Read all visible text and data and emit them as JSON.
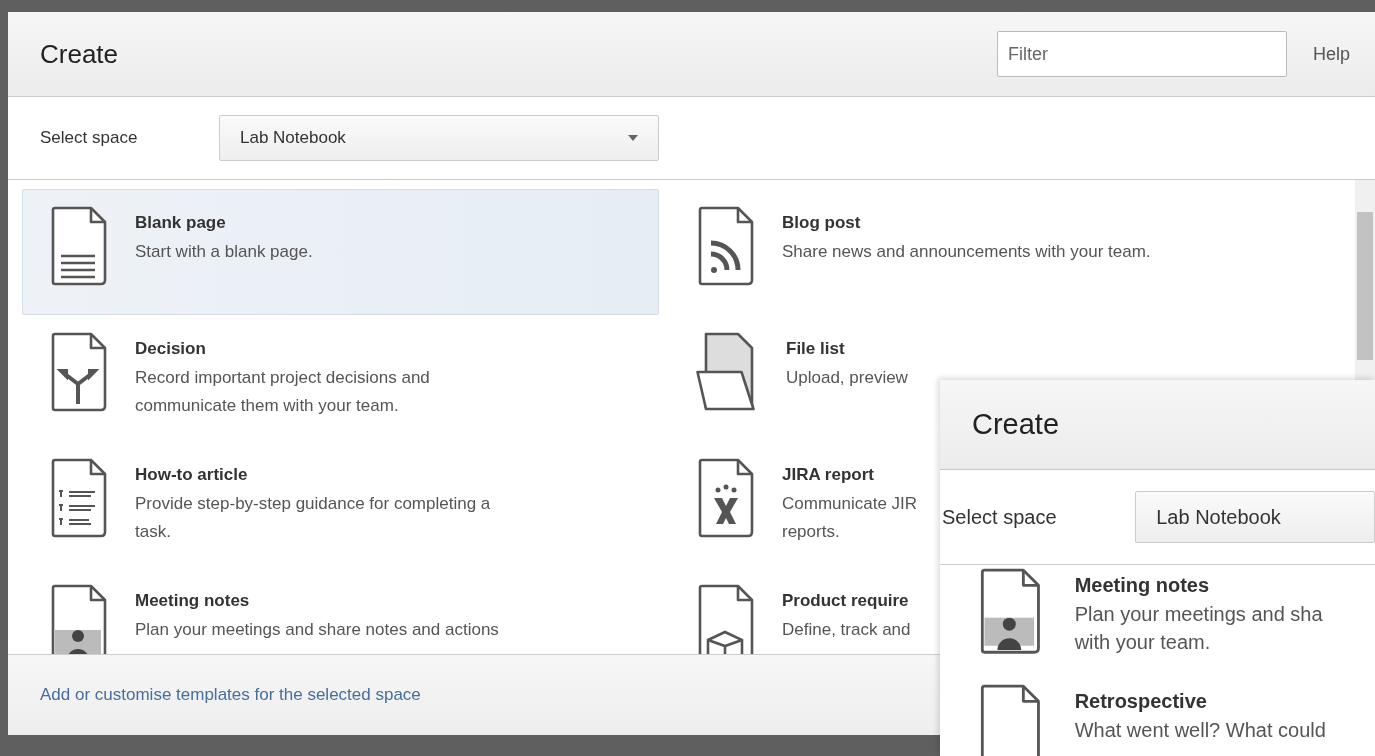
{
  "dialog": {
    "title": "Create",
    "filter": {
      "placeholder": "Filter"
    },
    "help": "Help",
    "space_label": "Select space",
    "space_value": "Lab Notebook",
    "templates": [
      {
        "kind": "blank",
        "title": "Blank page",
        "lines": [
          "Start with a blank page."
        ],
        "selected": true
      },
      {
        "kind": "blog",
        "title": "Blog post",
        "lines": [
          "Share news and announcements with your team."
        ],
        "selected": false
      },
      {
        "kind": "decision",
        "title": "Decision",
        "lines": [
          "Record important project decisions and",
          "communicate them with your team."
        ],
        "selected": false
      },
      {
        "kind": "folder",
        "title": "File list",
        "lines": [
          "Upload, preview"
        ],
        "selected": false
      },
      {
        "kind": "howto",
        "title": "How-to article",
        "lines": [
          "Provide step-by-step guidance for completing a",
          "task."
        ],
        "selected": false
      },
      {
        "kind": "jira",
        "title": "JIRA report",
        "lines": [
          "Communicate JIR",
          "reports."
        ],
        "selected": false
      },
      {
        "kind": "meeting",
        "title": "Meeting notes",
        "lines": [
          "Plan your meetings and share notes and actions"
        ],
        "selected": false
      },
      {
        "kind": "product",
        "title": "Product require",
        "lines": [
          "Define, track and"
        ],
        "selected": false
      }
    ],
    "footer_link": "Add or customise templates for the selected space"
  },
  "inset": {
    "title": "Create",
    "space_label": "Select space",
    "space_value": "Lab Notebook",
    "templates": [
      {
        "kind": "meeting",
        "title": "Meeting notes",
        "lines": [
          "Plan your meetings and sha",
          "with your team."
        ]
      },
      {
        "kind": "retro",
        "title": "Retrospective",
        "lines": [
          "What went well? What could"
        ]
      }
    ]
  }
}
